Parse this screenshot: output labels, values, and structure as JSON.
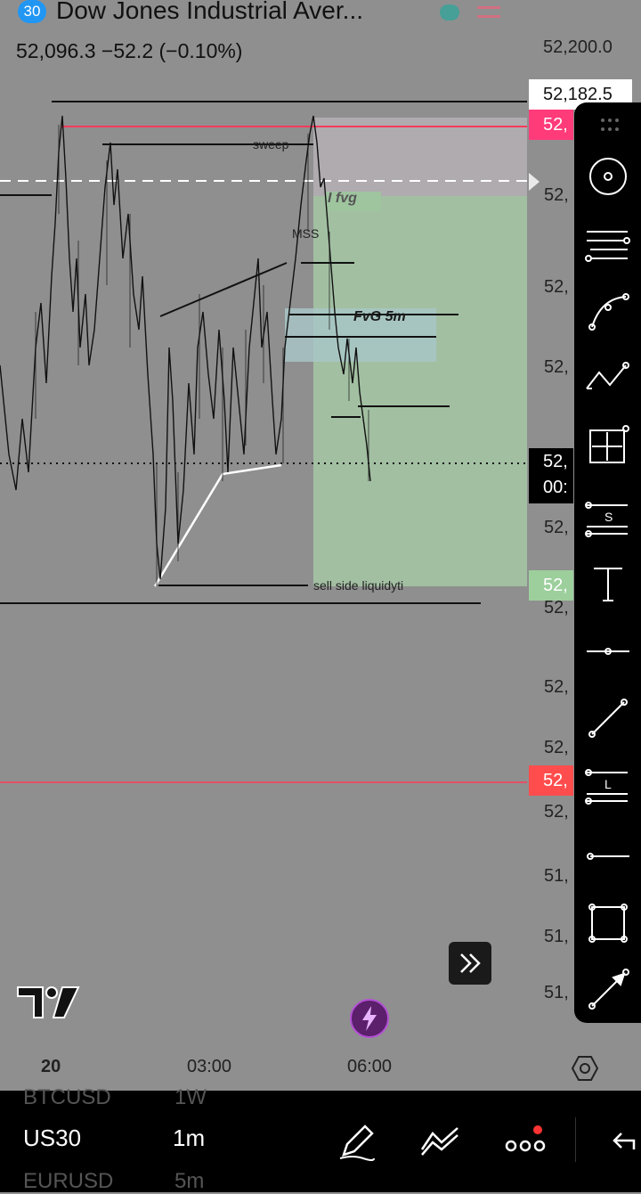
{
  "header": {
    "badge": "30",
    "title": "Dow Jones Industrial Aver...",
    "price_line": "52,096.3  −52.2 (−0.10%)"
  },
  "chart": {
    "annotations": {
      "sweep": "sweep",
      "fvg": "I fvg",
      "mss": "MSS",
      "fvg5m": "FvG 5m",
      "ssl": "sell side liquidyti"
    }
  },
  "yaxis": {
    "top": "52,200.0",
    "tag_current": "52,182.5",
    "tag_red": "52,",
    "l1": "52,",
    "l2": "52,",
    "l3": "52,",
    "tag_black_top": "52,",
    "tag_black_bottom": "00:",
    "l4": "52,",
    "tag_green": "52,",
    "l5": "52,",
    "l6": "52,",
    "l7": "52,",
    "tag_red2": "52,",
    "l8": "52,",
    "l9": "51,",
    "l10": "51,",
    "l11": "51,"
  },
  "xaxis": {
    "t1": "20",
    "t2": "03:00",
    "t3": "06:00"
  },
  "bottom": {
    "symbol_prev": "BTCUSD",
    "symbol": "US30",
    "symbol_next": "EURUSD",
    "interval_prev": "1W",
    "interval": "1m",
    "interval_next": "5m"
  },
  "colors": {
    "accent_red": "#ff3b5c",
    "accent_green": "#9ccf9c",
    "badge": "#2196f3"
  }
}
